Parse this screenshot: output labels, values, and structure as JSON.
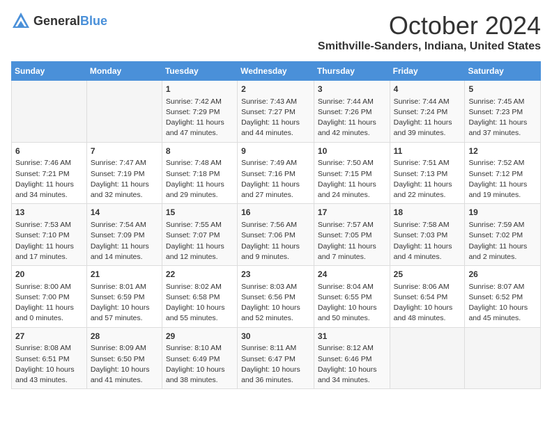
{
  "header": {
    "logo": {
      "general": "General",
      "blue": "Blue"
    },
    "month": "October 2024",
    "location": "Smithville-Sanders, Indiana, United States"
  },
  "days_of_week": [
    "Sunday",
    "Monday",
    "Tuesday",
    "Wednesday",
    "Thursday",
    "Friday",
    "Saturday"
  ],
  "weeks": [
    [
      {
        "day": "",
        "info": ""
      },
      {
        "day": "",
        "info": ""
      },
      {
        "day": "1",
        "info": "Sunrise: 7:42 AM\nSunset: 7:29 PM\nDaylight: 11 hours and 47 minutes."
      },
      {
        "day": "2",
        "info": "Sunrise: 7:43 AM\nSunset: 7:27 PM\nDaylight: 11 hours and 44 minutes."
      },
      {
        "day": "3",
        "info": "Sunrise: 7:44 AM\nSunset: 7:26 PM\nDaylight: 11 hours and 42 minutes."
      },
      {
        "day": "4",
        "info": "Sunrise: 7:44 AM\nSunset: 7:24 PM\nDaylight: 11 hours and 39 minutes."
      },
      {
        "day": "5",
        "info": "Sunrise: 7:45 AM\nSunset: 7:23 PM\nDaylight: 11 hours and 37 minutes."
      }
    ],
    [
      {
        "day": "6",
        "info": "Sunrise: 7:46 AM\nSunset: 7:21 PM\nDaylight: 11 hours and 34 minutes."
      },
      {
        "day": "7",
        "info": "Sunrise: 7:47 AM\nSunset: 7:19 PM\nDaylight: 11 hours and 32 minutes."
      },
      {
        "day": "8",
        "info": "Sunrise: 7:48 AM\nSunset: 7:18 PM\nDaylight: 11 hours and 29 minutes."
      },
      {
        "day": "9",
        "info": "Sunrise: 7:49 AM\nSunset: 7:16 PM\nDaylight: 11 hours and 27 minutes."
      },
      {
        "day": "10",
        "info": "Sunrise: 7:50 AM\nSunset: 7:15 PM\nDaylight: 11 hours and 24 minutes."
      },
      {
        "day": "11",
        "info": "Sunrise: 7:51 AM\nSunset: 7:13 PM\nDaylight: 11 hours and 22 minutes."
      },
      {
        "day": "12",
        "info": "Sunrise: 7:52 AM\nSunset: 7:12 PM\nDaylight: 11 hours and 19 minutes."
      }
    ],
    [
      {
        "day": "13",
        "info": "Sunrise: 7:53 AM\nSunset: 7:10 PM\nDaylight: 11 hours and 17 minutes."
      },
      {
        "day": "14",
        "info": "Sunrise: 7:54 AM\nSunset: 7:09 PM\nDaylight: 11 hours and 14 minutes."
      },
      {
        "day": "15",
        "info": "Sunrise: 7:55 AM\nSunset: 7:07 PM\nDaylight: 11 hours and 12 minutes."
      },
      {
        "day": "16",
        "info": "Sunrise: 7:56 AM\nSunset: 7:06 PM\nDaylight: 11 hours and 9 minutes."
      },
      {
        "day": "17",
        "info": "Sunrise: 7:57 AM\nSunset: 7:05 PM\nDaylight: 11 hours and 7 minutes."
      },
      {
        "day": "18",
        "info": "Sunrise: 7:58 AM\nSunset: 7:03 PM\nDaylight: 11 hours and 4 minutes."
      },
      {
        "day": "19",
        "info": "Sunrise: 7:59 AM\nSunset: 7:02 PM\nDaylight: 11 hours and 2 minutes."
      }
    ],
    [
      {
        "day": "20",
        "info": "Sunrise: 8:00 AM\nSunset: 7:00 PM\nDaylight: 11 hours and 0 minutes."
      },
      {
        "day": "21",
        "info": "Sunrise: 8:01 AM\nSunset: 6:59 PM\nDaylight: 10 hours and 57 minutes."
      },
      {
        "day": "22",
        "info": "Sunrise: 8:02 AM\nSunset: 6:58 PM\nDaylight: 10 hours and 55 minutes."
      },
      {
        "day": "23",
        "info": "Sunrise: 8:03 AM\nSunset: 6:56 PM\nDaylight: 10 hours and 52 minutes."
      },
      {
        "day": "24",
        "info": "Sunrise: 8:04 AM\nSunset: 6:55 PM\nDaylight: 10 hours and 50 minutes."
      },
      {
        "day": "25",
        "info": "Sunrise: 8:06 AM\nSunset: 6:54 PM\nDaylight: 10 hours and 48 minutes."
      },
      {
        "day": "26",
        "info": "Sunrise: 8:07 AM\nSunset: 6:52 PM\nDaylight: 10 hours and 45 minutes."
      }
    ],
    [
      {
        "day": "27",
        "info": "Sunrise: 8:08 AM\nSunset: 6:51 PM\nDaylight: 10 hours and 43 minutes."
      },
      {
        "day": "28",
        "info": "Sunrise: 8:09 AM\nSunset: 6:50 PM\nDaylight: 10 hours and 41 minutes."
      },
      {
        "day": "29",
        "info": "Sunrise: 8:10 AM\nSunset: 6:49 PM\nDaylight: 10 hours and 38 minutes."
      },
      {
        "day": "30",
        "info": "Sunrise: 8:11 AM\nSunset: 6:47 PM\nDaylight: 10 hours and 36 minutes."
      },
      {
        "day": "31",
        "info": "Sunrise: 8:12 AM\nSunset: 6:46 PM\nDaylight: 10 hours and 34 minutes."
      },
      {
        "day": "",
        "info": ""
      },
      {
        "day": "",
        "info": ""
      }
    ]
  ]
}
